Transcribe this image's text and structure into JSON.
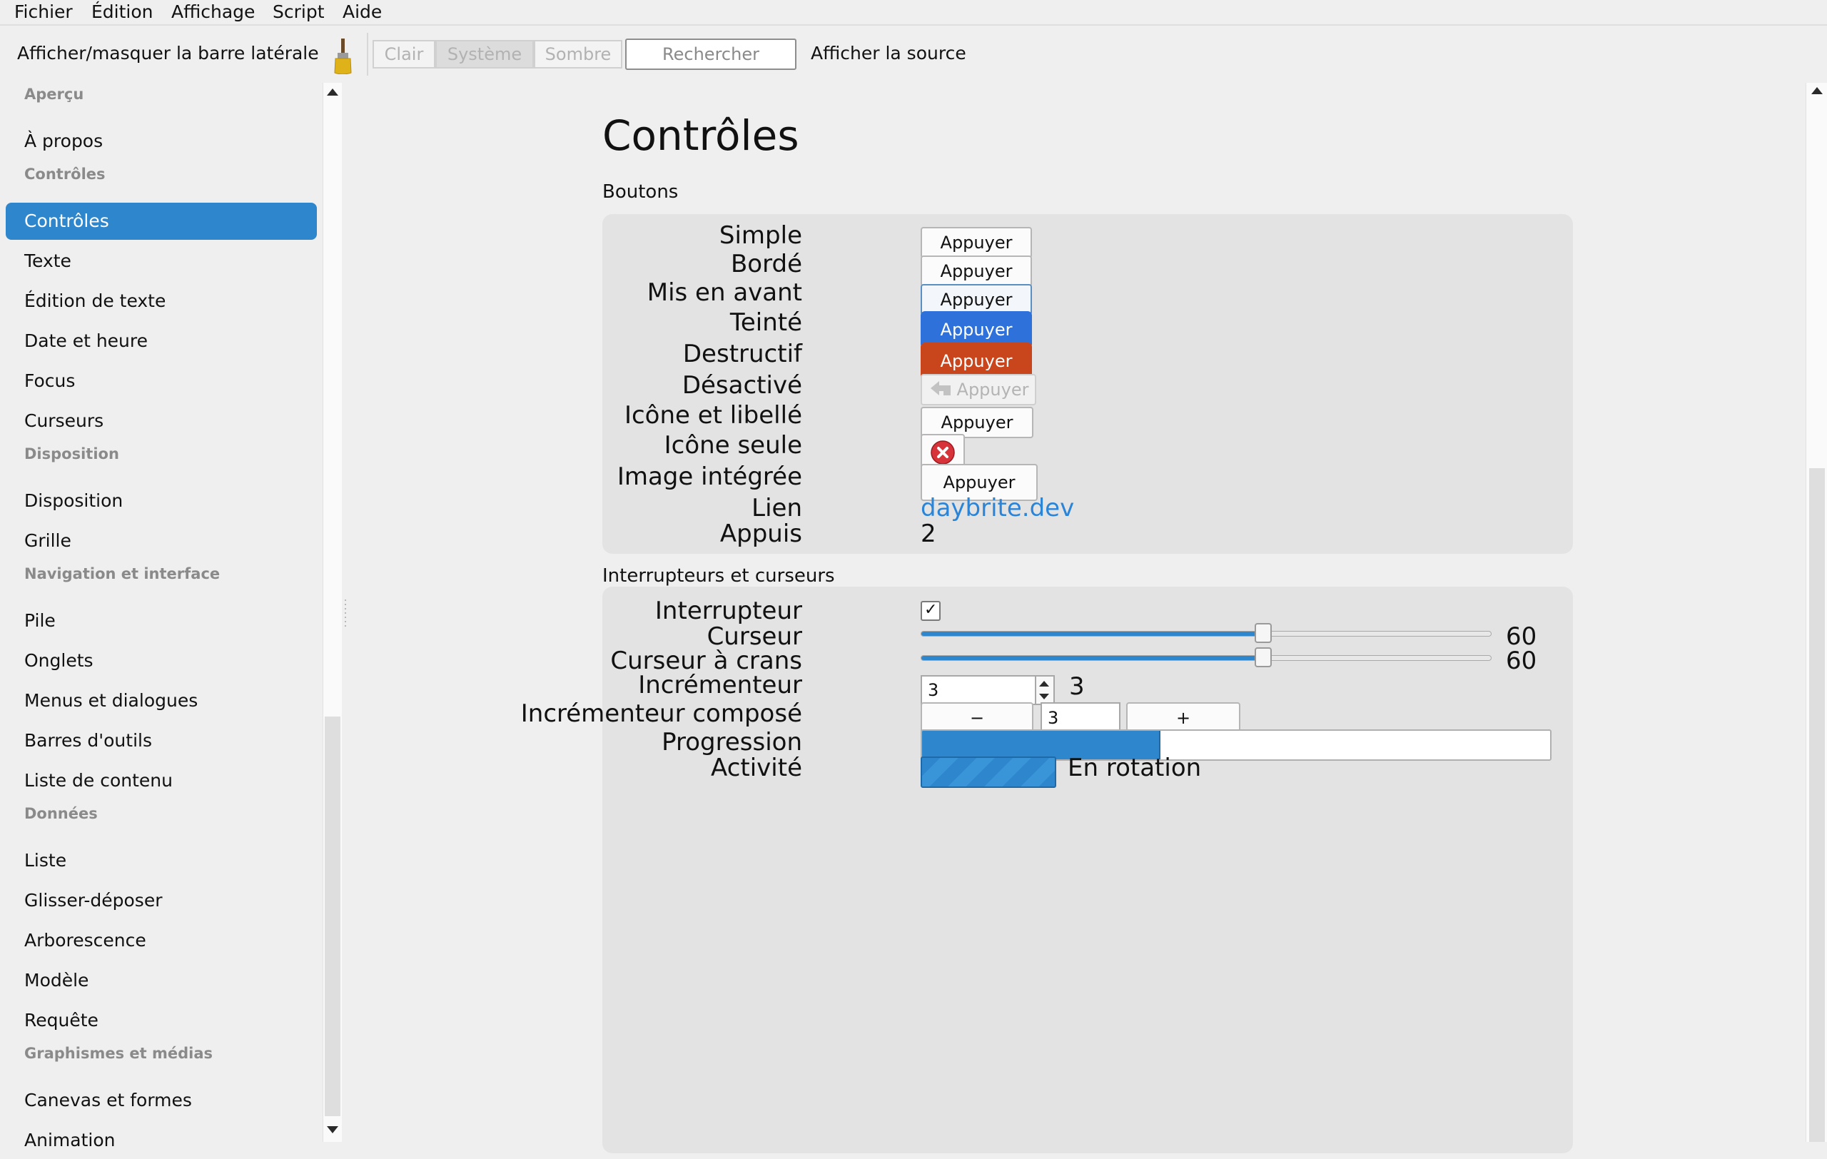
{
  "menubar": {
    "items": [
      "Fichier",
      "Édition",
      "Affichage",
      "Script",
      "Aide"
    ]
  },
  "toolbar": {
    "toggle_sidebar": "Afficher/masquer la barre latérale",
    "themes": {
      "light": "Clair",
      "system": "Système",
      "dark": "Sombre",
      "selected": "Système"
    },
    "search_placeholder": "Rechercher",
    "show_source": "Afficher la source"
  },
  "sidebar": {
    "selected": "Contrôles",
    "entries": [
      {
        "type": "header",
        "label": "Aperçu"
      },
      {
        "type": "item",
        "label": "À propos"
      },
      {
        "type": "header",
        "label": "Contrôles"
      },
      {
        "type": "item",
        "label": "Contrôles"
      },
      {
        "type": "item",
        "label": "Texte"
      },
      {
        "type": "item",
        "label": "Édition de texte"
      },
      {
        "type": "item",
        "label": "Date et heure"
      },
      {
        "type": "item",
        "label": "Focus"
      },
      {
        "type": "item",
        "label": "Curseurs"
      },
      {
        "type": "header",
        "label": "Disposition"
      },
      {
        "type": "item",
        "label": "Disposition"
      },
      {
        "type": "item",
        "label": "Grille"
      },
      {
        "type": "header",
        "label": "Navigation et interface"
      },
      {
        "type": "item",
        "label": "Pile"
      },
      {
        "type": "item",
        "label": "Onglets"
      },
      {
        "type": "item",
        "label": "Menus et dialogues"
      },
      {
        "type": "item",
        "label": "Barres d'outils"
      },
      {
        "type": "item",
        "label": "Liste de contenu"
      },
      {
        "type": "header",
        "label": "Données"
      },
      {
        "type": "item",
        "label": "Liste"
      },
      {
        "type": "item",
        "label": "Glisser-déposer"
      },
      {
        "type": "item",
        "label": "Arborescence"
      },
      {
        "type": "item",
        "label": "Modèle"
      },
      {
        "type": "item",
        "label": "Requête"
      },
      {
        "type": "header",
        "label": "Graphismes et médias"
      },
      {
        "type": "item",
        "label": "Canevas et formes"
      },
      {
        "type": "item",
        "label": "Animation"
      }
    ]
  },
  "content": {
    "title": "Contrôles",
    "buttons_section": {
      "title": "Boutons",
      "button_label": "Appuyer",
      "rows": {
        "plain": "Simple",
        "bordered": "Bordé",
        "highlighted": "Mis en avant",
        "tinted": "Teinté",
        "destructive": "Destructif",
        "disabled": "Désactivé",
        "icon_label": "Icône et libellé",
        "icon_only": "Icône seule",
        "image": "Image intégrée",
        "link": "Lien",
        "presses": "Appuis"
      },
      "link_text": "daybrite.dev",
      "press_count": "2"
    },
    "switches_section": {
      "title": "Interrupteurs et curseurs",
      "switch": {
        "label": "Interrupteur",
        "checked": true,
        "mark": "✓"
      },
      "slider": {
        "label": "Curseur",
        "value": 60,
        "value_text": "60",
        "min": 0,
        "max": 100
      },
      "step_slider": {
        "label": "Curseur à crans",
        "value": 60,
        "value_text": "60",
        "min": 0,
        "max": 100
      },
      "stepper": {
        "label": "Incrémenteur",
        "value": "3",
        "value_text": "3"
      },
      "compound_stepper": {
        "label": "Incrémenteur composé",
        "minus": "−",
        "plus": "+",
        "value": "3"
      },
      "progress": {
        "label": "Progression",
        "fraction": 0.38
      },
      "activity": {
        "label": "Activité",
        "status": "En rotation"
      }
    }
  }
}
